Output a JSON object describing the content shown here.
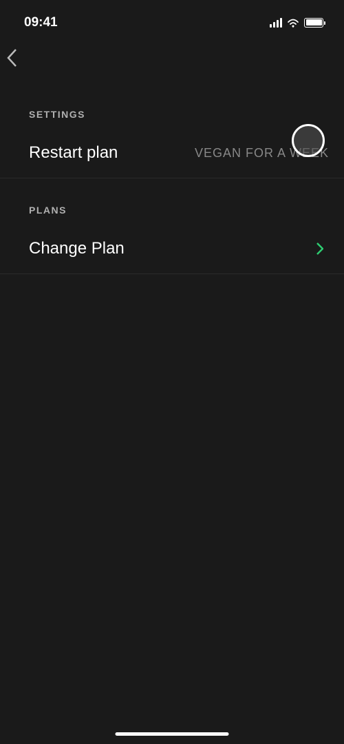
{
  "statusBar": {
    "time": "09:41"
  },
  "sections": {
    "settings": {
      "header": "SETTINGS",
      "items": {
        "restartPlan": {
          "label": "Restart plan",
          "value": "VEGAN FOR A WEEK"
        }
      }
    },
    "plans": {
      "header": "PLANS",
      "items": {
        "changePlan": {
          "label": "Change Plan"
        }
      }
    }
  }
}
